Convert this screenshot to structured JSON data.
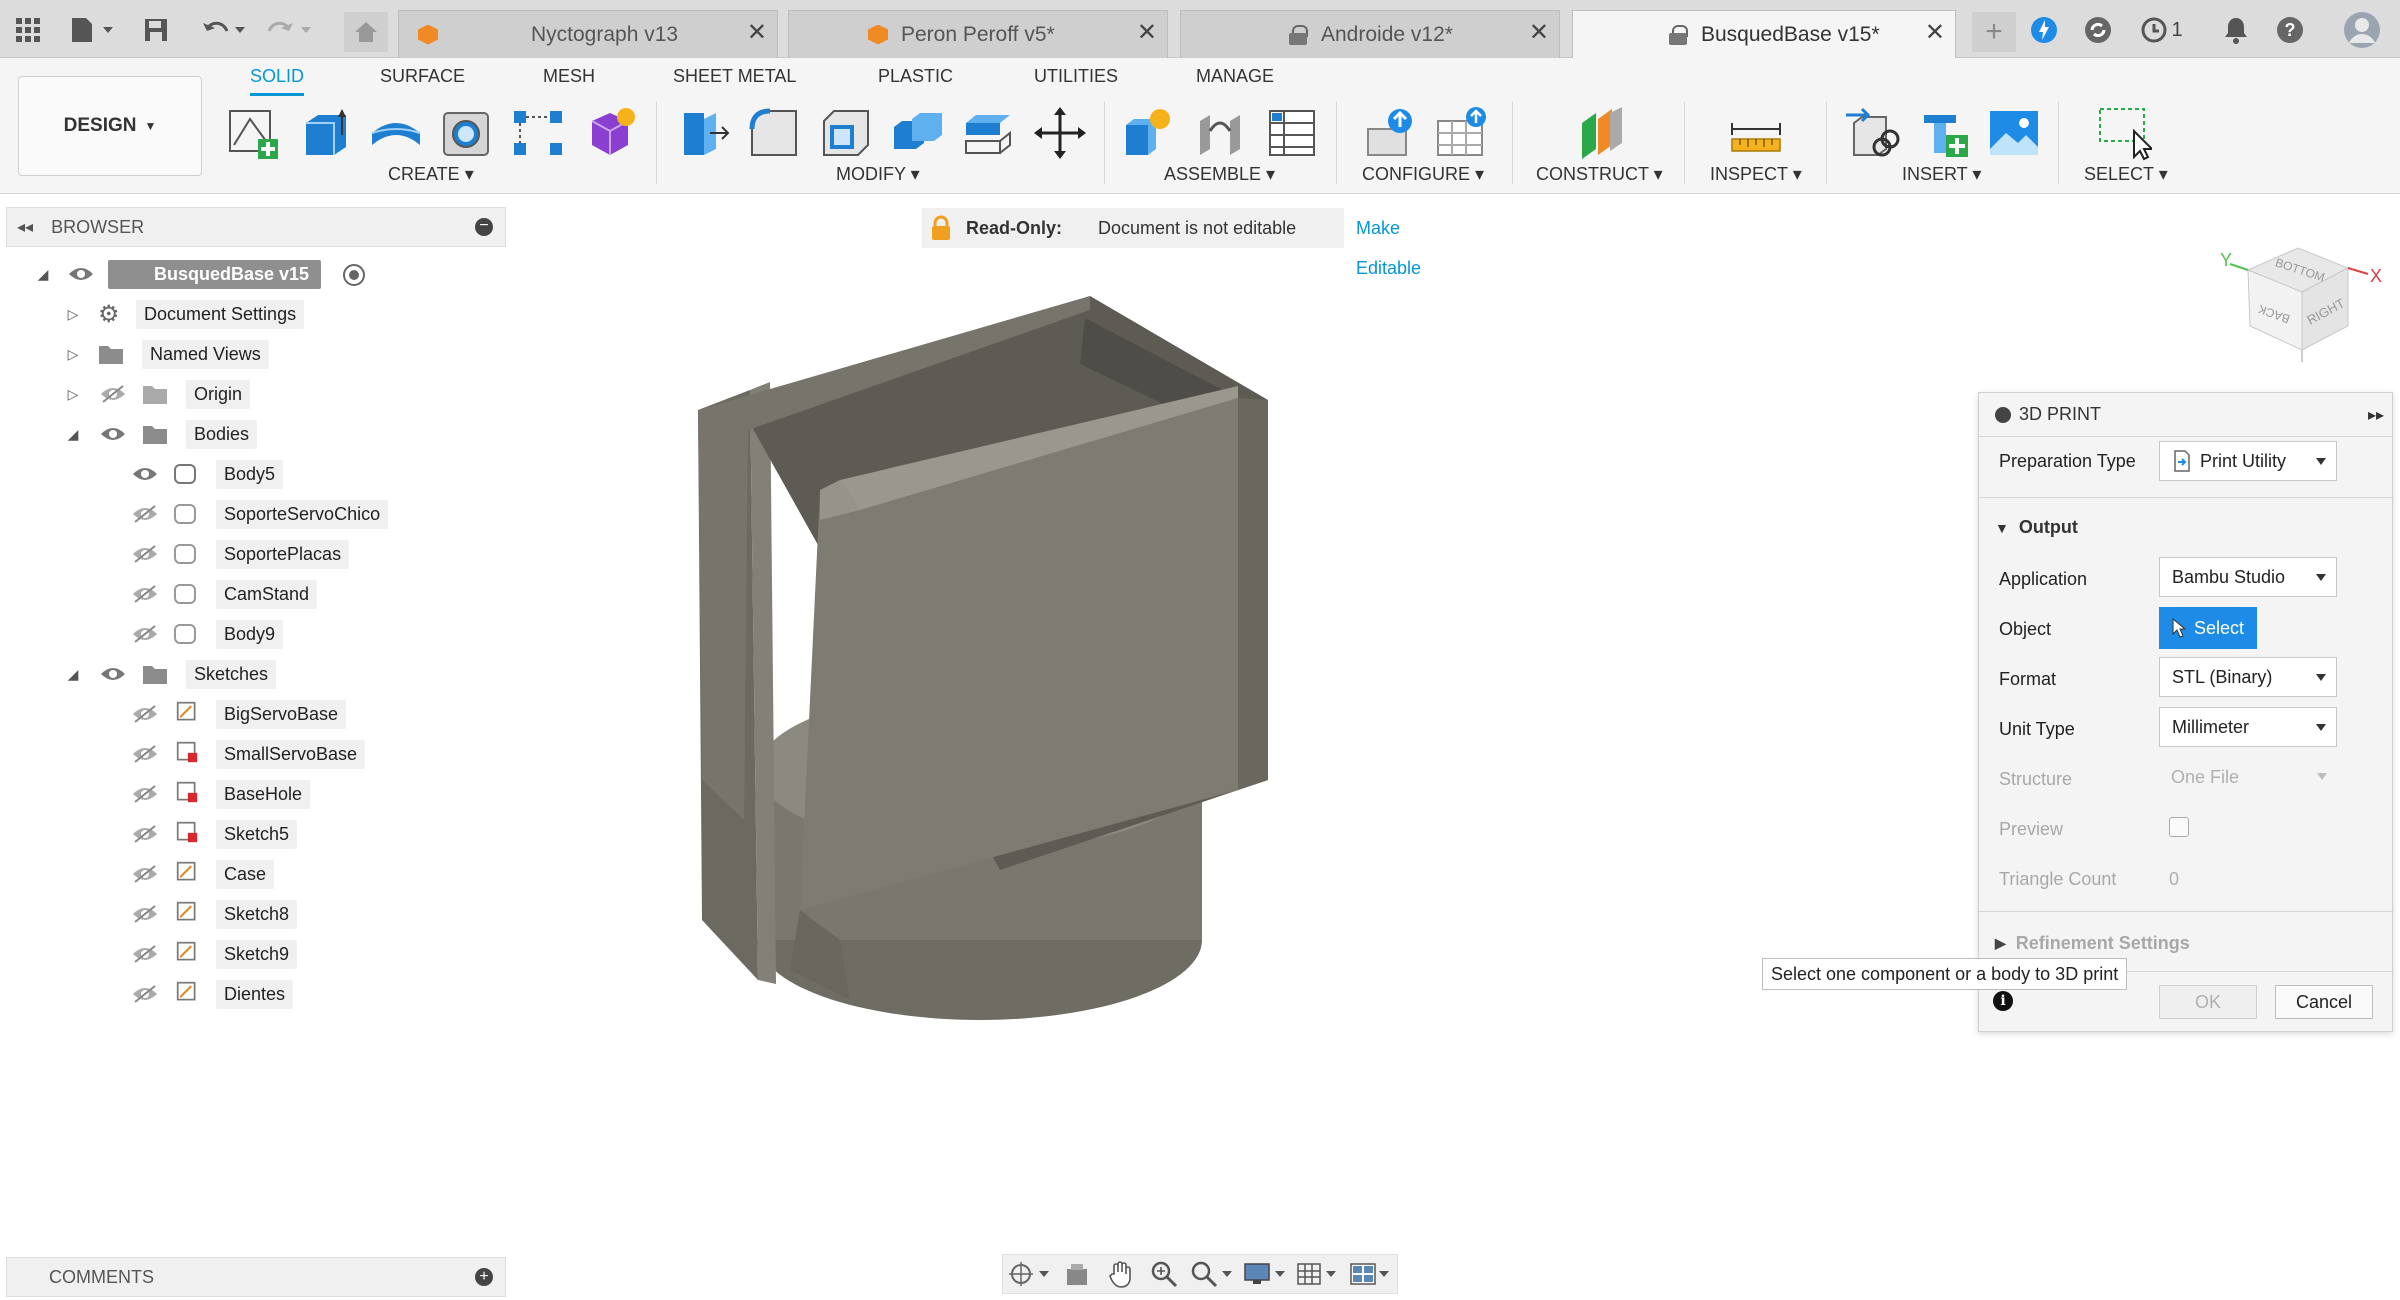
{
  "tabs": [
    {
      "label": "Nyctograph v13",
      "icon": "orange-cube-icon"
    },
    {
      "label": "Peron Peroff v5*",
      "icon": "orange-cube-icon"
    },
    {
      "label": "Androide v12*",
      "icon": "lock-icon"
    },
    {
      "label": "BusquedBase v15*",
      "icon": "lock-icon",
      "active": true
    }
  ],
  "header_right": {
    "jobs_count": "1"
  },
  "toolbar": {
    "design_label": "DESIGN",
    "workspace_tabs": [
      "SOLID",
      "SURFACE",
      "MESH",
      "SHEET METAL",
      "PLASTIC",
      "UTILITIES",
      "MANAGE"
    ],
    "groups": [
      "CREATE",
      "MODIFY",
      "ASSEMBLE",
      "CONFIGURE",
      "CONSTRUCT",
      "INSPECT",
      "INSERT",
      "SELECT"
    ]
  },
  "browser": {
    "title": "BROWSER",
    "root": "BusquedBase v15",
    "items": {
      "document_settings": "Document Settings",
      "named_views": "Named Views",
      "origin": "Origin",
      "bodies": "Bodies",
      "sketches": "Sketches"
    },
    "bodies": [
      "Body5",
      "SoporteServoChico",
      "SoportePlacas",
      "CamStand",
      "Body9"
    ],
    "sketches": [
      "BigServoBase",
      "SmallServoBase",
      "BaseHole",
      "Sketch5",
      "Case",
      "Sketch8",
      "Sketch9",
      "Dientes"
    ]
  },
  "readonly": {
    "label": "Read-Only:",
    "message": "Document is not editable",
    "action": "Make Editable"
  },
  "viewcube": {
    "top": "BOTTOM",
    "front": "BACK",
    "right": "RIGHT",
    "axis_x": "X",
    "axis_y": "Y"
  },
  "print_panel": {
    "title": "3D PRINT",
    "preparation_type_label": "Preparation Type",
    "preparation_type_value": "Print Utility",
    "output_label": "Output",
    "application_label": "Application",
    "application_value": "Bambu Studio",
    "object_label": "Object",
    "object_button": "Select",
    "format_label": "Format",
    "format_value": "STL (Binary)",
    "unit_type_label": "Unit Type",
    "unit_type_value": "Millimeter",
    "structure_label": "Structure",
    "structure_value": "One File",
    "preview_label": "Preview",
    "triangle_count_label": "Triangle Count",
    "triangle_count_value": "0",
    "refinement_label": "Refinement Settings",
    "ok_label": "OK",
    "cancel_label": "Cancel"
  },
  "tooltip": "Select one component or a body to 3D print",
  "comments": {
    "title": "COMMENTS"
  },
  "colors": {
    "accent": "#0696d7",
    "select_button": "#1e8ce6",
    "model_face": "#7a776e",
    "model_top": "#8c8980"
  }
}
